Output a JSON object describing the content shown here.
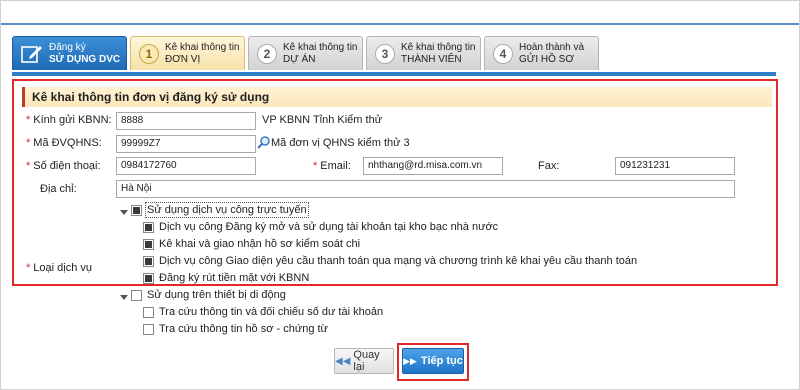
{
  "steps": [
    {
      "line1": "Đăng ký",
      "line2": "SỬ DỤNG DVC",
      "state": "done",
      "icon": "pencil-icon"
    },
    {
      "num": "1",
      "line1": "Kê khai thông tin",
      "line2": "ĐƠN VỊ",
      "state": "active"
    },
    {
      "num": "2",
      "line1": "Kê khai thông tin",
      "line2": "DỰ ÁN",
      "state": "todo"
    },
    {
      "num": "3",
      "line1": "Kê khai thông tin",
      "line2": "THÀNH VIÊN",
      "state": "todo"
    },
    {
      "num": "4",
      "line1": "Hoàn thành và",
      "line2": "GỬI HỒ SƠ",
      "state": "todo"
    }
  ],
  "section_title": "Kê khai thông tin đơn vị đăng ký sử dụng",
  "form": {
    "kbnn_label": "Kính gửi KBNN:",
    "kbnn_value": "8888",
    "kbnn_name": "VP KBNN Tỉnh Kiểm thử",
    "dvqhns_label": "Mã ĐVQHNS:",
    "dvqhns_value": "99999Z7",
    "dvqhns_name": "Mã đơn vị QHNS kiểm thử 3",
    "phone_label": "Số điện thoại:",
    "phone_value": "0984172760",
    "email_label": "Email:",
    "email_value": "nhthang@rd.misa.com.vn",
    "fax_label": "Fax:",
    "fax_value": "091231231",
    "address_label": "Địa chỉ:",
    "address_value": "Hà Nội",
    "service_label": "Loại dịch vụ"
  },
  "services": {
    "online_group": "Sử dụng dịch vụ công trực tuyến",
    "online_items": [
      "Dịch vụ công Đăng ký mở và sử dụng tài khoản tại kho bạc nhà nước",
      "Kê khai và giao nhận hồ sơ kiểm soát chi",
      "Dịch vụ công Giao diện yêu cầu thanh toán qua mạng và chương trình kê khai yêu cầu thanh toán",
      "Đăng ký rút tiền mặt với KBNN"
    ],
    "mobile_group": "Sử dụng trên thiết bị di động",
    "mobile_items": [
      "Tra cứu thông tin và đối chiếu số dư tài khoản",
      "Tra cứu thông tin hồ sơ - chứng từ"
    ]
  },
  "buttons": {
    "back": "Quay lại",
    "next": "Tiếp tục"
  },
  "colors": {
    "accent": "#2f7fc8",
    "highlight": "#e02a2a"
  }
}
